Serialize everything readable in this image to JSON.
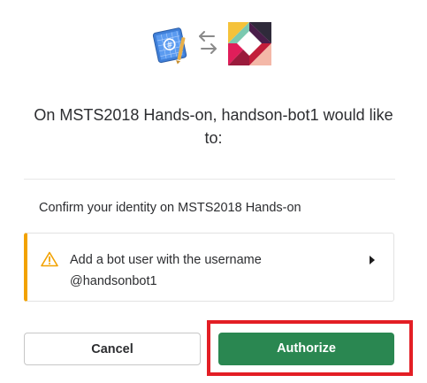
{
  "header": {
    "app_icon": "compose-blueprint-icon",
    "exchange_icon": "swap-arrows-icon",
    "slack_icon": "slack-logo-icon"
  },
  "dialog": {
    "title": "On MSTS2018 Hands-on, handson-bot1 would like to:",
    "identity_text": "Confirm your identity on MSTS2018 Hands-on",
    "permission": {
      "line1": "Add a bot user with the username",
      "line2": "@handsonbot1",
      "icon": "warning-icon",
      "expand_icon": "caret-right-icon"
    },
    "cancel_label": "Cancel",
    "authorize_label": "Authorize"
  },
  "colors": {
    "accent_warning": "#f2a200",
    "authorize_bg": "#2a8751",
    "highlight": "#e31e25"
  }
}
